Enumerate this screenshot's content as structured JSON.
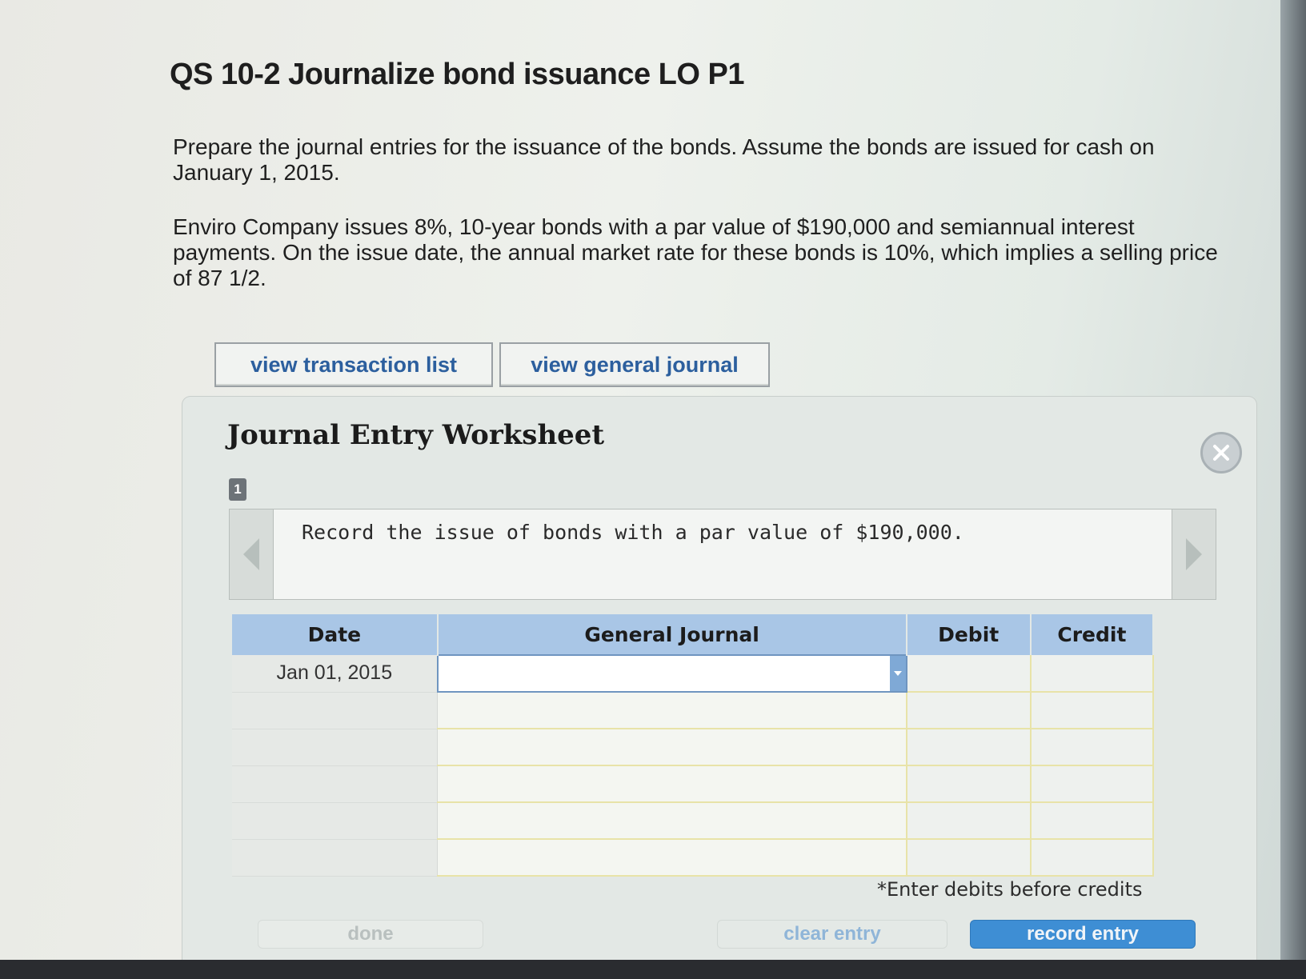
{
  "page": {
    "title": "QS 10-2 Journalize bond issuance LO P1",
    "instructions": "Prepare the journal entries for the issuance of the bonds. Assume the bonds are issued for cash on January 1, 2015.",
    "scenario": "Enviro Company issues 8%, 10-year bonds with a par value of $190,000 and semiannual interest payments. On the issue date, the annual market rate for these bonds is 10%, which implies a selling price of 87 1/2."
  },
  "tabs": {
    "transaction_list": "view transaction list",
    "general_journal": "view general journal"
  },
  "worksheet": {
    "title": "Journal Entry Worksheet",
    "step": "1",
    "instruction": "Record the issue of bonds with a par value of $190,000.",
    "columns": {
      "date": "Date",
      "general_journal": "General Journal",
      "debit": "Debit",
      "credit": "Credit"
    },
    "rows": [
      {
        "date": "Jan 01, 2015",
        "account": "",
        "debit": "",
        "credit": ""
      },
      {
        "date": "",
        "account": "",
        "debit": "",
        "credit": ""
      },
      {
        "date": "",
        "account": "",
        "debit": "",
        "credit": ""
      },
      {
        "date": "",
        "account": "",
        "debit": "",
        "credit": ""
      },
      {
        "date": "",
        "account": "",
        "debit": "",
        "credit": ""
      },
      {
        "date": "",
        "account": "",
        "debit": "",
        "credit": ""
      }
    ],
    "hint": "*Enter debits before credits",
    "buttons": {
      "done": "done",
      "clear": "clear entry",
      "record": "record entry"
    }
  },
  "icons": {
    "close": "close-icon",
    "prev": "left-arrow-icon",
    "next": "right-arrow-icon",
    "dropdown": "chevron-down-icon"
  },
  "colors": {
    "header_blue": "#a9c6e6",
    "link_blue": "#2c5f9e",
    "record_button": "#3e8ed4",
    "grid_yellow": "#e8e3a8"
  }
}
